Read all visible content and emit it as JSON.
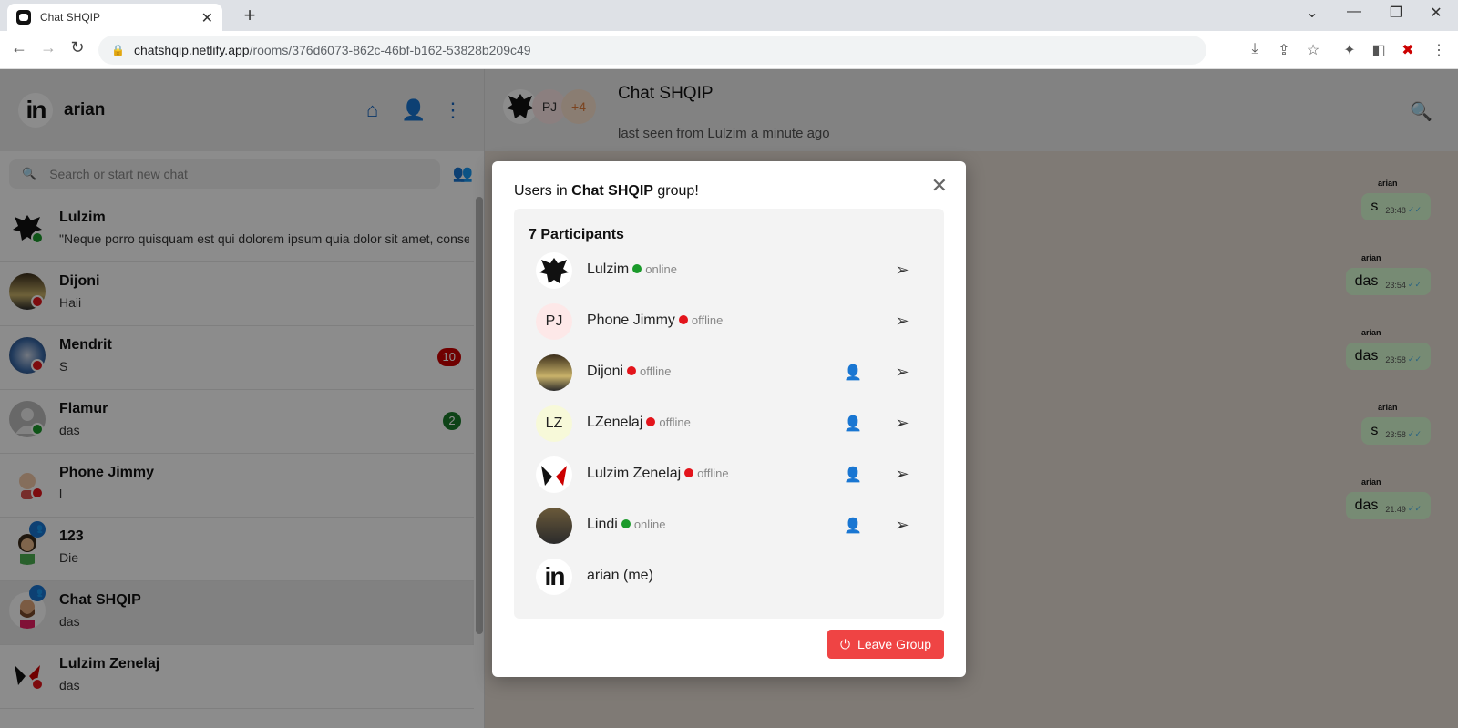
{
  "browser": {
    "tab_title": "Chat SHQIP",
    "url_host": "chatshqip.netlify.app",
    "url_path": "/rooms/376d6073-862c-46bf-b162-53828b209c49"
  },
  "sidebar": {
    "username": "arian",
    "search_placeholder": "Search or start new chat",
    "chats": [
      {
        "name": "Lulzim",
        "message": "\"Neque porro quisquam est qui dolorem ipsum quia dolor sit amet, conse",
        "status": "online"
      },
      {
        "name": "Dijoni",
        "message": "Haii",
        "status": "offline"
      },
      {
        "name": "Mendrit",
        "message": "S",
        "status": "offline",
        "unread": "10"
      },
      {
        "name": "Flamur",
        "message": "das",
        "status": "online",
        "unread": "2"
      },
      {
        "name": "Phone Jimmy",
        "message": "l",
        "status": "offline"
      },
      {
        "name": "123",
        "message": "Die",
        "group": true
      },
      {
        "name": "Chat SHQIP",
        "message": "das",
        "group": true,
        "active": true
      },
      {
        "name": "Lulzim Zenelaj",
        "message": "das",
        "status": "offline"
      }
    ]
  },
  "room": {
    "title": "Chat SHQIP",
    "subtitle": "last seen from Lulzim a minute ago",
    "avatar_initials": "PJ",
    "extra_count": "+4",
    "messages": [
      {
        "author": "arian",
        "text": "s",
        "time": "23:48"
      },
      {
        "author": "arian",
        "text": "das",
        "time": "23:54"
      },
      {
        "author": "arian",
        "text": "das",
        "time": "23:58"
      },
      {
        "author": "arian",
        "text": "s",
        "time": "23:58"
      },
      {
        "author": "arian",
        "text": "das",
        "time": "21:49"
      }
    ]
  },
  "modal": {
    "title_prefix": "Users in",
    "title_group": "Chat SHQIP",
    "title_suffix": "group!",
    "participants_count": "7 Participants",
    "participants": [
      {
        "name": "Lulzim",
        "status": "online"
      },
      {
        "name": "Phone Jimmy",
        "status": "offline",
        "initials": "PJ"
      },
      {
        "name": "Dijoni",
        "status": "offline"
      },
      {
        "name": "LZenelaj",
        "status": "offline",
        "initials": "LZ"
      },
      {
        "name": "Lulzim Zenelaj",
        "status": "offline"
      },
      {
        "name": "Lindi",
        "status": "online"
      },
      {
        "name": "arian (me)"
      }
    ],
    "leave_label": "Leave Group"
  },
  "colors": {
    "online": "#1a9a2a",
    "offline": "#e3141b",
    "accent": "#1565c0",
    "leave": "#ef4444"
  }
}
